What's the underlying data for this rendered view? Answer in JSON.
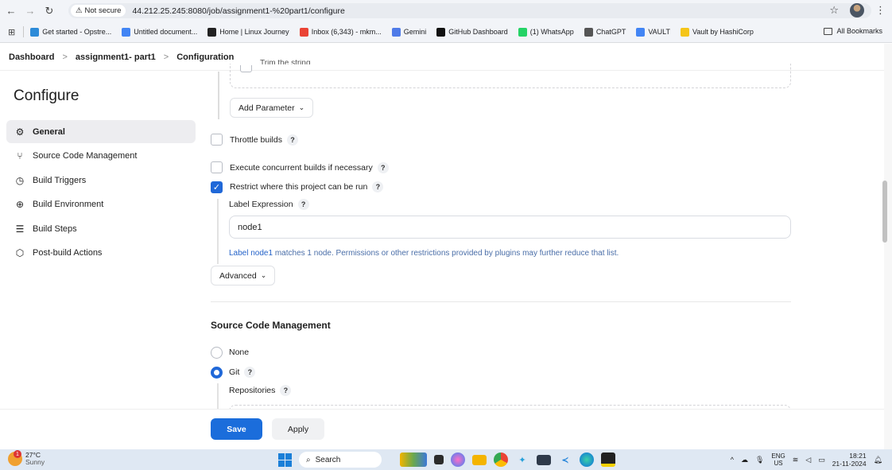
{
  "browser": {
    "security_label": "Not secure",
    "url": "44.212.25.245:8080/job/assignment1-%20part1/configure",
    "bookmarks": [
      {
        "label": "Get started - Opstre...",
        "icon": "puzzle-icon",
        "color": "#2d8bd8"
      },
      {
        "label": "Untitled document...",
        "icon": "doc-icon",
        "color": "#4285f4"
      },
      {
        "label": "Home | Linux Journey",
        "icon": "linux-icon",
        "color": "#222222"
      },
      {
        "label": "Inbox (6,343) - mkm...",
        "icon": "gmail-icon",
        "color": "#ea4335"
      },
      {
        "label": "Gemini",
        "icon": "gemini-icon",
        "color": "#4f7be8"
      },
      {
        "label": "GitHub Dashboard",
        "icon": "github-icon",
        "color": "#111111"
      },
      {
        "label": "(1) WhatsApp",
        "icon": "whatsapp-icon",
        "color": "#25d366"
      },
      {
        "label": "ChatGPT",
        "icon": "chatgpt-icon",
        "color": "#555555"
      },
      {
        "label": "VAULT",
        "icon": "vault-icon",
        "color": "#4285f4"
      },
      {
        "label": "Vault by HashiCorp",
        "icon": "hashicorp-icon",
        "color": "#f5c518"
      }
    ],
    "all_bookmarks_label": "All Bookmarks"
  },
  "breadcrumb": [
    "Dashboard",
    "assignment1- part1",
    "Configuration"
  ],
  "sidebar": {
    "title": "Configure",
    "items": [
      {
        "label": "General",
        "icon": "gear-icon",
        "active": true
      },
      {
        "label": "Source Code Management",
        "icon": "branch-icon",
        "active": false
      },
      {
        "label": "Build Triggers",
        "icon": "clock-icon",
        "active": false
      },
      {
        "label": "Build Environment",
        "icon": "globe-icon",
        "active": false
      },
      {
        "label": "Build Steps",
        "icon": "list-icon",
        "active": false
      },
      {
        "label": "Post-build Actions",
        "icon": "box-icon",
        "active": false
      }
    ]
  },
  "general": {
    "trim_label": "Trim the string",
    "add_parameter_label": "Add Parameter",
    "throttle_label": "Throttle builds",
    "concurrent_label": "Execute concurrent builds if necessary",
    "restrict_label": "Restrict where this project can be run",
    "label_expression_label": "Label Expression",
    "label_expression_value": "node1",
    "label_link": "Label node1",
    "label_info": " matches 1 node. Permissions or other restrictions provided by plugins may further reduce that list.",
    "advanced_label": "Advanced",
    "help_glyph": "?"
  },
  "scm": {
    "title": "Source Code Management",
    "none_label": "None",
    "git_label": "Git",
    "repositories_label": "Repositories"
  },
  "actions": {
    "save_label": "Save",
    "apply_label": "Apply"
  },
  "taskbar": {
    "weather_temp": "27°C",
    "weather_desc": "Sunny",
    "weather_badge": "1",
    "search_label": "Search",
    "lang_top": "ENG",
    "lang_bottom": "US",
    "time": "18:21",
    "date": "21-11-2024"
  }
}
